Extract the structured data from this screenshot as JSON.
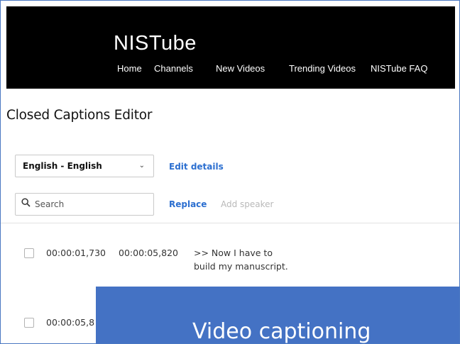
{
  "header": {
    "brand": "NISTube",
    "nav": [
      "Home",
      "Channels",
      "New Videos",
      "Trending Videos",
      "NISTube FAQ"
    ]
  },
  "page": {
    "title": "Closed Captions Editor"
  },
  "language_select": {
    "value": "English - English"
  },
  "links": {
    "edit_details": "Edit details",
    "replace": "Replace",
    "add_speaker": "Add speaker"
  },
  "search": {
    "placeholder": "Search"
  },
  "captions": [
    {
      "start": "00:00:01,730",
      "end": "00:00:05,820",
      "line1": ">> Now I have to",
      "line2": "build my manuscript."
    },
    {
      "start": "00:00:05,8"
    }
  ],
  "overlay": {
    "text": "Video captioning"
  },
  "colors": {
    "header_bg": "#000000",
    "link": "#2c6fd0",
    "banner": "#4472c4",
    "frame": "#4a78c2"
  }
}
